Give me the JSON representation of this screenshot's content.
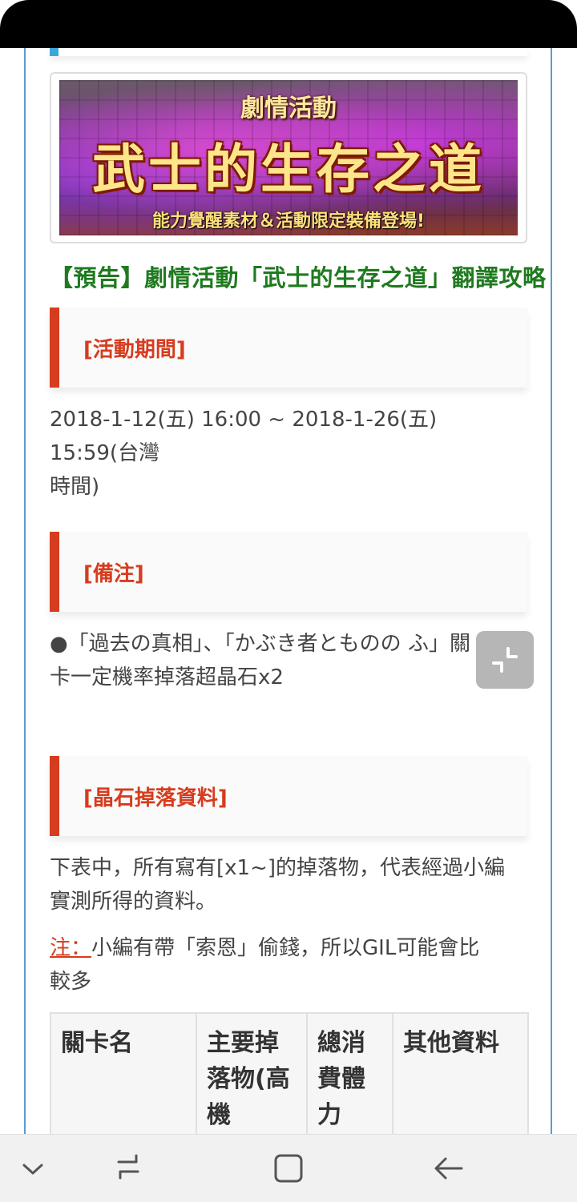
{
  "banner": {
    "tag": "劇情活動",
    "title": "武士的生存之道",
    "subtitle": "能力覺醒素材＆活動限定裝備登場!"
  },
  "article_title": "【預告】劇情活動「武士的生存之道」翻譯攻略",
  "sections": {
    "period": {
      "heading": "[活動期間]",
      "text_line1": "2018-1-12(五) 16:00 ~ 2018-1-26(五) 15:59(台灣",
      "text_line2": "時間)"
    },
    "notes": {
      "heading": "[備注]",
      "text_line1": "●「過去の真相」、「かぶき者とものの ふ」關",
      "text_line2": "卡一定機率掉落超晶石x2"
    },
    "drops": {
      "heading": "[晶石掉落資料]",
      "desc_line1": "下表中，所有寫有[x1~]的掉落物，代表經過小編",
      "desc_line2": "實測所得的資料。",
      "note_label": "注：",
      "note_line1": "小編有帶「索恩」偷錢，所以GIL可能會比",
      "note_line2": "較多"
    }
  },
  "table": {
    "headers": [
      "關卡名",
      "主要掉落物(高機",
      "總消費體力",
      "其他資料"
    ]
  },
  "colors": {
    "accent_red": "#d63c1e",
    "title_green": "#1f7a1f",
    "frame_blue": "#5a9bd5"
  },
  "icons": {
    "float_button": "fullscreen-exit-icon",
    "nav": [
      "chevron-down-icon",
      "recent-apps-icon",
      "home-icon",
      "back-icon"
    ]
  }
}
